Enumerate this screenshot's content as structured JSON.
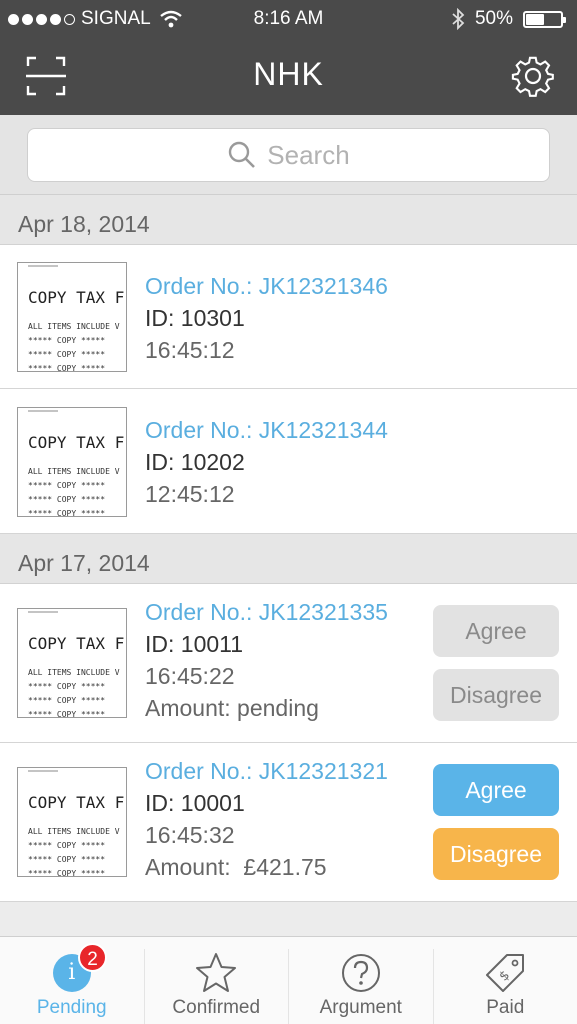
{
  "status_bar": {
    "carrier": "SIGNAL",
    "time": "8:16 AM",
    "battery_text": "50%",
    "battery_level": 0.5
  },
  "nav": {
    "title": "NHK"
  },
  "search": {
    "placeholder": "Search"
  },
  "receipt": {
    "heading": "COPY TAX F",
    "line1": "ALL ITEMS INCLUDE V",
    "line2": "***** COPY *****"
  },
  "groups": [
    {
      "date": "Apr 18, 2014",
      "orders": [
        {
          "order_no": "Order No.: JK12321346",
          "id": "ID: 10301",
          "time": "16:45:12"
        },
        {
          "order_no": "Order No.: JK12321344",
          "id": "ID: 10202",
          "time": "12:45:12"
        }
      ]
    },
    {
      "date": "Apr 17, 2014",
      "orders": [
        {
          "order_no": "Order No.: JK12321335",
          "id": "ID: 10011",
          "time": "16:45:22",
          "amount": "Amount: pending",
          "agree": "Agree",
          "disagree": "Disagree"
        },
        {
          "order_no": "Order No.: JK12321321",
          "id": "ID: 10001",
          "time": "16:45:32",
          "amount": "Amount:  £421.75",
          "agree": "Agree",
          "disagree": "Disagree"
        }
      ]
    }
  ],
  "tabs": [
    {
      "label": "Pending",
      "badge": "2",
      "icon": "info-icon"
    },
    {
      "label": "Confirmed",
      "icon": "star-icon"
    },
    {
      "label": "Argument",
      "icon": "question-icon"
    },
    {
      "label": "Paid",
      "icon": "price-tag-icon"
    }
  ],
  "colors": {
    "accent": "#5ab4e8",
    "order_link": "#5aaedf",
    "agree": "#5ab4e8",
    "disagree": "#f7b54b",
    "badge": "#e8262a",
    "nav_bg": "#4a4a4a"
  }
}
